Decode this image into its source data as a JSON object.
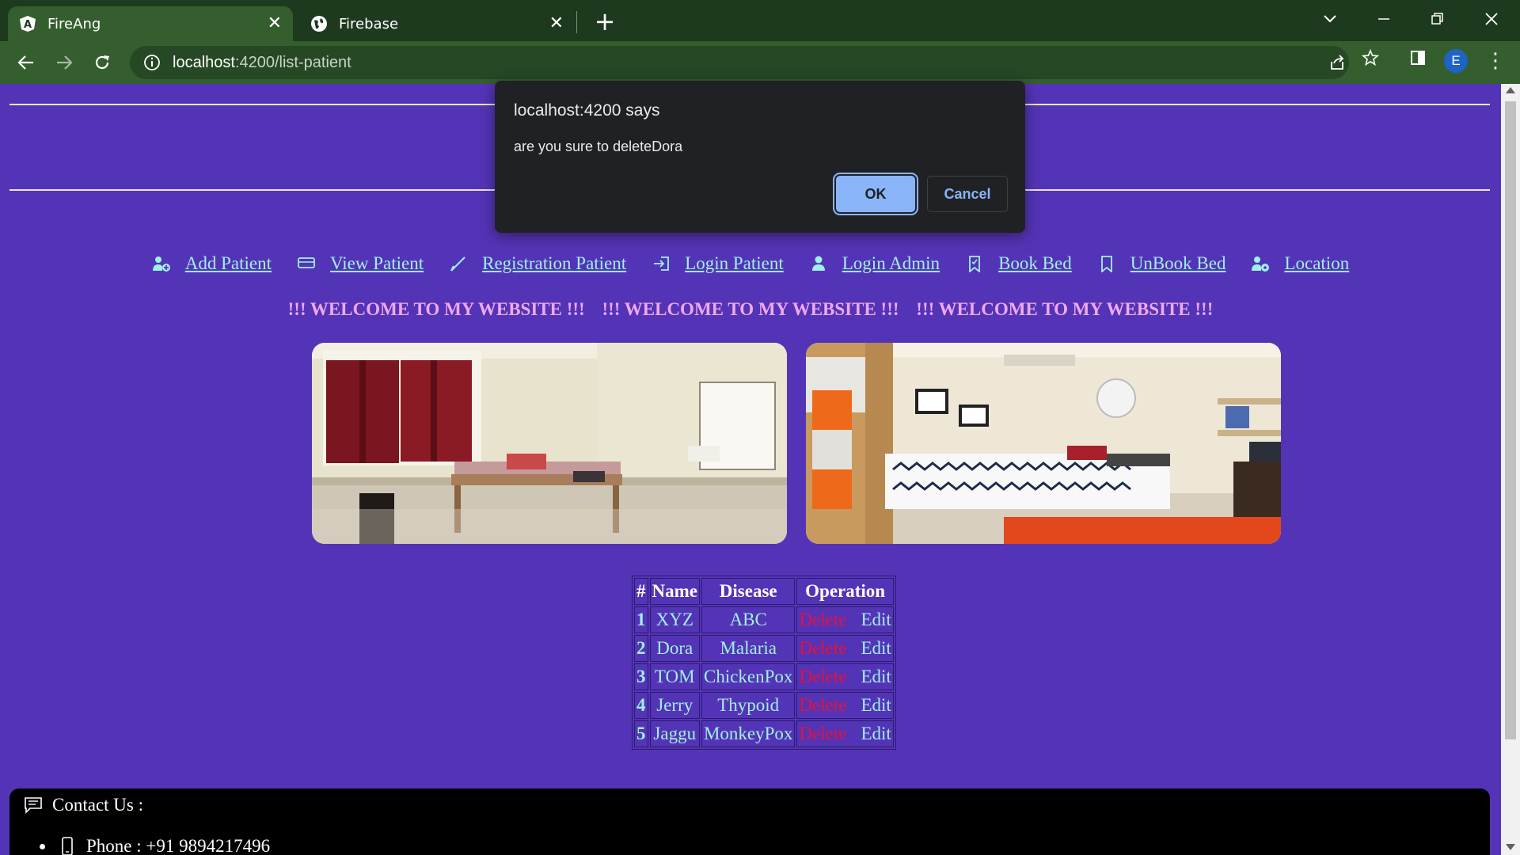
{
  "browser": {
    "tabs": [
      {
        "title": "FireAng",
        "active": true
      },
      {
        "title": "Firebase",
        "active": false
      }
    ],
    "url_host": "localhost",
    "url_path": ":4200/list-patient",
    "profile_initial": "E"
  },
  "nav": {
    "links": [
      {
        "label": "Add Patient",
        "icon": "user-plus-icon"
      },
      {
        "label": "View Patient",
        "icon": "card-icon"
      },
      {
        "label": "Registration Patient",
        "icon": "pen-icon"
      },
      {
        "label": "Login Patient",
        "icon": "login-icon"
      },
      {
        "label": "Login Admin",
        "icon": "user-icon"
      },
      {
        "label": "Book Bed",
        "icon": "bookmark-icon"
      },
      {
        "label": "UnBook Bed",
        "icon": "bookmark-icon"
      },
      {
        "label": "Location",
        "icon": "user-location-icon"
      }
    ]
  },
  "welcome": {
    "items": [
      "!!! WELCOME TO MY WEBSITE !!!",
      "!!! WELCOME TO MY WEBSITE !!!",
      "!!! WELCOME TO MY WEBSITE !!!"
    ]
  },
  "table": {
    "headers": [
      "#",
      "Name",
      "Disease",
      "Operation"
    ],
    "rows": [
      {
        "num": "1",
        "name": "XYZ",
        "disease": "ABC"
      },
      {
        "num": "2",
        "name": "Dora",
        "disease": "Malaria"
      },
      {
        "num": "3",
        "name": "TOM",
        "disease": "ChickenPox"
      },
      {
        "num": "4",
        "name": "Jerry",
        "disease": "Thypoid"
      },
      {
        "num": "5",
        "name": "Jaggu",
        "disease": "MonkeyPox"
      }
    ],
    "delete_label": "Delete",
    "edit_label": "Edit"
  },
  "footer": {
    "contact_label": "Contact Us :",
    "phone": "Phone : +91 9894217496"
  },
  "dialog": {
    "title": "localhost:4200 says",
    "message": "are you sure to deleteDora",
    "ok_label": "OK",
    "cancel_label": "Cancel"
  },
  "colors": {
    "page_bg": "#5434b6",
    "link": "#9ff0e6",
    "welcome": "#f0a8f0",
    "delete": "#e8103a",
    "chrome": "#355e2f"
  }
}
